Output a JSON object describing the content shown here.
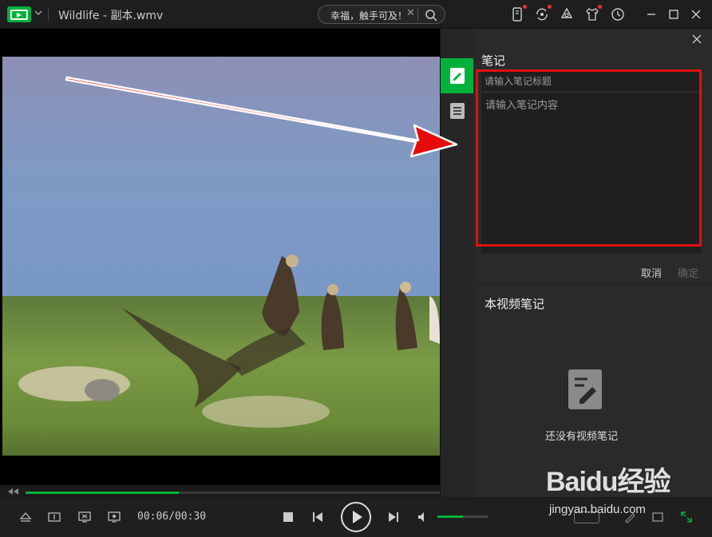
{
  "titlebar": {
    "window_title": "Wildlife - 副本.wmv",
    "search_text": "幸福，触手可及！",
    "search_clear": "✕"
  },
  "notes_panel": {
    "heading": "笔记",
    "title_placeholder": "请输入笔记标题",
    "content_placeholder": "请输入笔记内容",
    "cancel_label": "取消",
    "confirm_label": "确定",
    "video_notes_heading": "本视频笔记",
    "empty_text": "还没有视频笔记"
  },
  "player": {
    "time": "00:06/00:30",
    "progress_fraction": 0.37,
    "volume_fraction": 0.5
  },
  "colors": {
    "accent": "#00b23b",
    "highlight_box": "#e01010"
  },
  "watermark": {
    "line1": "Baidu经验",
    "line2": "jingyan.baidu.com"
  },
  "icons": [
    "logo-icon",
    "chevron-down-icon",
    "search-icon",
    "phone-icon",
    "sync-icon",
    "recycle-icon",
    "shirt-icon",
    "clock-icon",
    "minimize-icon",
    "maximize-icon",
    "close-icon",
    "note-icon",
    "list-icon",
    "eject-icon",
    "play-icon",
    "stop-icon",
    "previous-icon",
    "next-icon",
    "volume-icon",
    "fullscreen-icon"
  ]
}
